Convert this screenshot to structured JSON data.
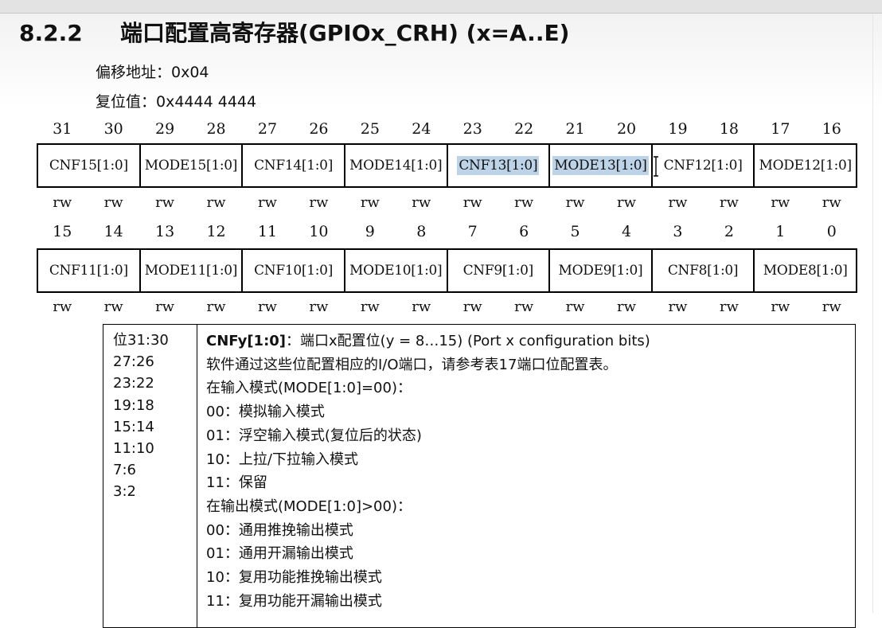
{
  "section": {
    "number": "8.2.2",
    "title": "端口配置高寄存器(GPIOx_CRH) (x=A..E)"
  },
  "offset": {
    "label": "偏移地址：",
    "value": "0x04"
  },
  "reset": {
    "label": "复位值：",
    "value": "0x4444 4444"
  },
  "register_high": {
    "bit_numbers": [
      "31",
      "30",
      "29",
      "28",
      "27",
      "26",
      "25",
      "24",
      "23",
      "22",
      "21",
      "20",
      "19",
      "18",
      "17",
      "16"
    ],
    "fields": [
      "CNF15[1:0]",
      "MODE15[1:0]",
      "CNF14[1:0]",
      "MODE14[1:0]",
      "CNF13[1:0]",
      "MODE13[1:0]",
      "CNF12[1:0]",
      "MODE12[1:0]"
    ],
    "access": [
      "rw",
      "rw",
      "rw",
      "rw",
      "rw",
      "rw",
      "rw",
      "rw",
      "rw",
      "rw",
      "rw",
      "rw",
      "rw",
      "rw",
      "rw",
      "rw"
    ]
  },
  "register_low": {
    "bit_numbers": [
      "15",
      "14",
      "13",
      "12",
      "11",
      "10",
      "9",
      "8",
      "7",
      "6",
      "5",
      "4",
      "3",
      "2",
      "1",
      "0"
    ],
    "fields": [
      "CNF11[1:0]",
      "MODE11[1:0]",
      "CNF10[1:0]",
      "MODE10[1:0]",
      "CNF9[1:0]",
      "MODE9[1:0]",
      "CNF8[1:0]",
      "MODE8[1:0]"
    ],
    "access": [
      "rw",
      "rw",
      "rw",
      "rw",
      "rw",
      "rw",
      "rw",
      "rw",
      "rw",
      "rw",
      "rw",
      "rw",
      "rw",
      "rw",
      "rw",
      "rw"
    ]
  },
  "selection": {
    "highlight_color": "#bcd3e8"
  },
  "description": {
    "bits": [
      "位31:30",
      "27:26",
      "23:22",
      "19:18",
      "15:14",
      "11:10",
      "7:6",
      "3:2"
    ],
    "field_name": "CNFy[1:0]",
    "field_title": "：端口x配置位(y = 8…15) (Port x configuration bits)",
    "lines": [
      "软件通过这些位配置相应的I/O端口，请参考表17端口位配置表。",
      "在输入模式(MODE[1:0]=00)：",
      "00：模拟输入模式",
      "01：浮空输入模式(复位后的状态)",
      "10：上拉/下拉输入模式",
      "11：保留",
      "在输出模式(MODE[1:0]>00)：",
      "00：通用推挽输出模式",
      "01：通用开漏输出模式",
      "10：复用功能推挽输出模式",
      "11：复用功能开漏输出模式"
    ]
  }
}
